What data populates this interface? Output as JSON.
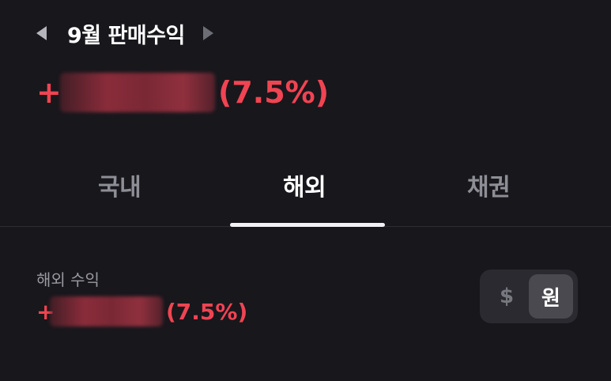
{
  "header": {
    "month_title": "9월 판매수익"
  },
  "total_profit": {
    "sign": "+",
    "percent": "(7.5%)"
  },
  "tabs": [
    {
      "label": "국내",
      "selected": false
    },
    {
      "label": "해외",
      "selected": true
    },
    {
      "label": "채권",
      "selected": false
    }
  ],
  "overseas": {
    "label": "해외 수익",
    "sign": "+",
    "percent": "(7.5%)"
  },
  "currency_toggle": {
    "usd_label": "$",
    "krw_label": "원",
    "selected": "원"
  },
  "colors": {
    "background": "#18171c",
    "profit_red": "#f04452",
    "text_primary": "#ffffff",
    "text_secondary": "#8e8e96"
  }
}
